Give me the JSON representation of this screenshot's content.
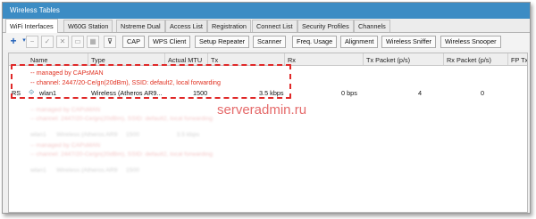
{
  "window": {
    "title": "Wireless Tables"
  },
  "tabs": [
    "WiFi Interfaces",
    "W60G Station",
    "Nstreme Dual",
    "Access List",
    "Registration",
    "Connect List",
    "Security Profiles",
    "Channels"
  ],
  "toolbar": {
    "buttons": [
      "CAP",
      "WPS Client",
      "Setup Repeater",
      "Scanner",
      "Freq. Usage",
      "Alignment",
      "Wireless Sniffer",
      "Wireless Snooper"
    ]
  },
  "columns": [
    "Name",
    "Type",
    "Actual MTU",
    "Tx",
    "Rx",
    "Tx Packet (p/s)",
    "Rx Packet (p/s)",
    "FP Tx"
  ],
  "comments": [
    "-- managed by CAPsMAN",
    "-- channel: 2447/20-Ce/gn(20dBm), SSID: default2, local forwarding"
  ],
  "rows": [
    {
      "flags": "RS",
      "name": "wlan1",
      "type": "Wireless (Atheros AR9...",
      "mtu": "1500",
      "tx": "3.5 kbps",
      "rx": "0 bps",
      "tx_packet": "4",
      "rx_packet": "0"
    }
  ],
  "watermark": "serveradmin.ru"
}
